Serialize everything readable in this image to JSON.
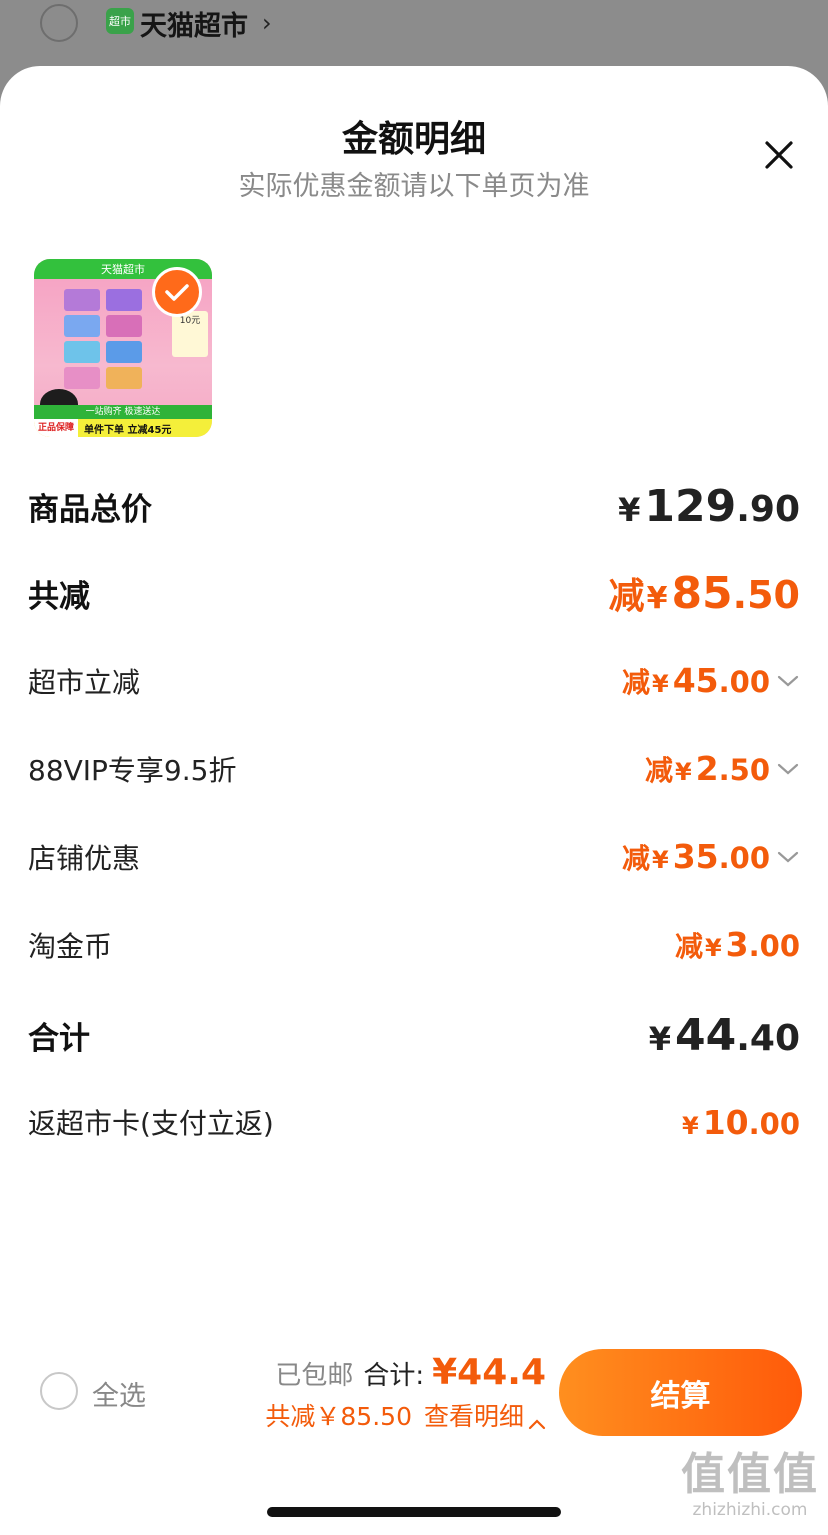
{
  "background_header": {
    "shop_icon_text": "超市",
    "shop_name": "天猫超市"
  },
  "sheet": {
    "title": "金额明细",
    "subtitle": "实际优惠金额请以下单页为准"
  },
  "product": {
    "thumb_top_text": "天猫超市",
    "thumb_card_text": "10元",
    "thumb_bar_text": "一站购齐 极速送达",
    "thumb_badge_text": "正品保障",
    "thumb_promo_text": "单件下单 立减45元",
    "selected": true
  },
  "rows": [
    {
      "label": "商品总价",
      "prefix": "",
      "yen": "¥",
      "int": "129",
      "dec": ".90",
      "style": "total",
      "chevron": false
    },
    {
      "label": "共减",
      "prefix": "减",
      "yen": "¥",
      "int": "85",
      "dec": ".50",
      "style": "discount-total",
      "chevron": false
    },
    {
      "label": "超市立减",
      "prefix": "减",
      "yen": "¥",
      "int": "45",
      "dec": ".00",
      "style": "discount",
      "chevron": true
    },
    {
      "label": "88VIP专享9.5折",
      "prefix": "减",
      "yen": "¥",
      "int": "2",
      "dec": ".50",
      "style": "discount",
      "chevron": true
    },
    {
      "label": "店铺优惠",
      "prefix": "减",
      "yen": "¥",
      "int": "35",
      "dec": ".00",
      "style": "discount",
      "chevron": true
    },
    {
      "label": "淘金币",
      "prefix": "减",
      "yen": "¥",
      "int": "3",
      "dec": ".00",
      "style": "discount",
      "chevron": false
    },
    {
      "label": "合计",
      "prefix": "",
      "yen": "¥",
      "int": "44",
      "dec": ".40",
      "style": "total",
      "chevron": false
    },
    {
      "label": "返超市卡(支付立返)",
      "prefix": "",
      "yen": "¥",
      "int": "10",
      "dec": ".00",
      "style": "cashback",
      "chevron": false
    }
  ],
  "footer": {
    "select_all": "全选",
    "free_shipping": "已包邮",
    "total_label": "合计:",
    "total_amount": "¥44.4",
    "discount_text": "共减￥85.50",
    "detail_link": "查看明细",
    "checkout": "结算"
  },
  "watermark": {
    "glyphs": "值值值",
    "domain": "zhizhizhi.com"
  },
  "colors": {
    "accent_orange": "#f35b0b",
    "checkout_gradient_start": "#ff8f1f",
    "checkout_gradient_end": "#ff5a0a",
    "overlay": "#8c8c8c"
  }
}
